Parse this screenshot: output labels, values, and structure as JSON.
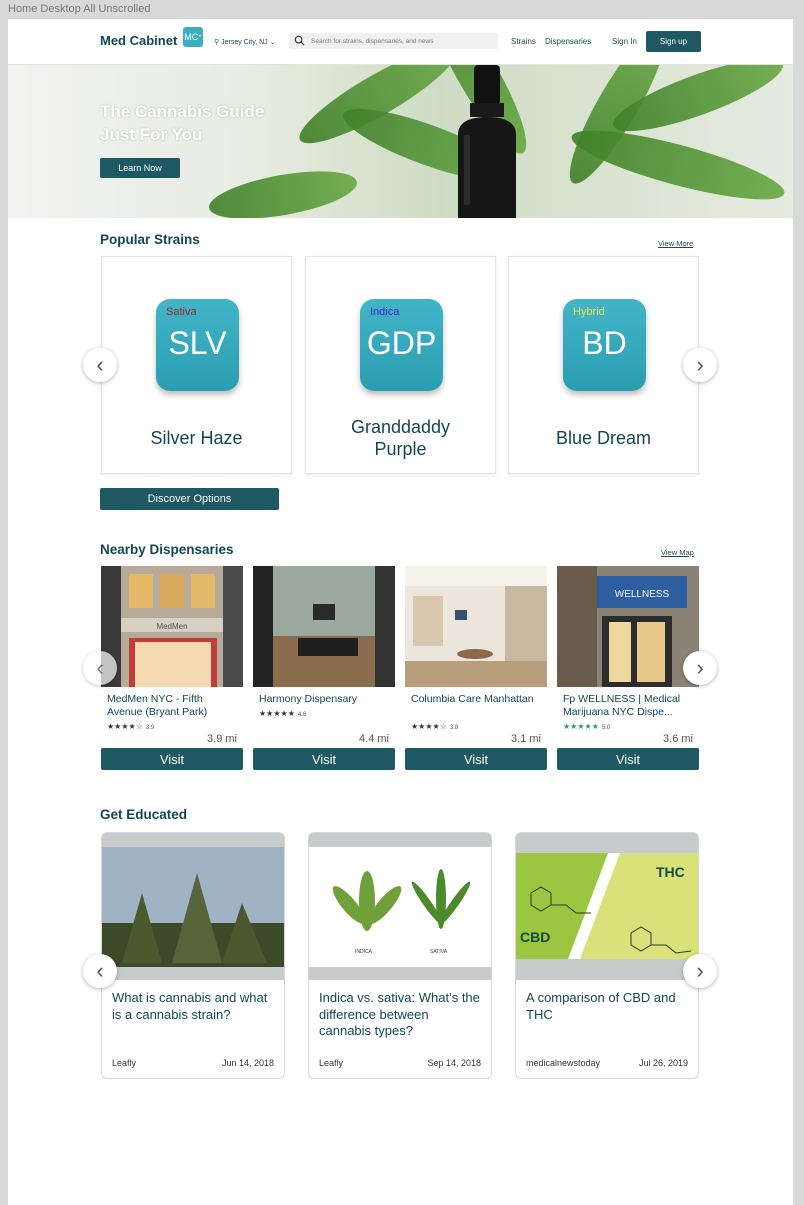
{
  "frame_title": "Home Desktop All Unscrolled",
  "header": {
    "logo_text": "Med Cabinet",
    "logo_badge": "MC",
    "location": "Jersey City, NJ",
    "search_placeholder": "Search for strains, dispensaries, and news",
    "nav": [
      "Strains",
      "Dispensaries"
    ],
    "sign_in": "Sign In",
    "sign_up": "Sign up"
  },
  "hero": {
    "title_line1": "The Cannabis Guide",
    "title_line2": "Just For You",
    "button": "Learn Now"
  },
  "popular": {
    "title": "Popular Strains",
    "view_more": "View More",
    "strains": [
      {
        "type": "Sativa",
        "abbr": "SLV",
        "name_line1": "Silver Haze",
        "name_line2": "",
        "type_color": "#8b2a2a"
      },
      {
        "type": "Indica",
        "abbr": "GDP",
        "name_line1": "Granddaddy",
        "name_line2": "Purple",
        "type_color": "#3b22c9"
      },
      {
        "type": "Hybrid",
        "abbr": "BD",
        "name_line1": "Blue Dream",
        "name_line2": "",
        "type_color": "#f2e84a"
      }
    ],
    "discover": "Discover Options"
  },
  "dispensaries": {
    "title": "Nearby Dispensaries",
    "view_map": "View Map",
    "items": [
      {
        "name": "MedMen NYC - Fifth Avenue (Bryant Park)",
        "stars": "★★★★☆",
        "rating": "3.9",
        "distance": "3.9 mi",
        "visit": "Visit"
      },
      {
        "name": "Harmony Dispensary",
        "stars": "★★★★★",
        "rating": "4.6",
        "distance": "4.4 mi",
        "visit": "Visit"
      },
      {
        "name": "Columbia Care Manhattan",
        "stars": "★★★★☆",
        "rating": "3.8",
        "distance": "3.1 mi",
        "visit": "Visit"
      },
      {
        "name": "Fp WELLNESS | Medical Marijuana NYC Dispe...",
        "stars": "★★★★★",
        "rating": "5.0",
        "distance": "3.6 mi",
        "visit": "Visit"
      }
    ]
  },
  "education": {
    "title": "Get Educated",
    "articles": [
      {
        "title": "What is cannabis and what is a cannabis strain?",
        "source": "Leafly",
        "date": "Jun 14, 2018"
      },
      {
        "title": "Indica vs. sativa: What’s the difference between cannabis types?",
        "source": "Leafly",
        "date": "Sep 14, 2018",
        "label_left": "INDICA",
        "label_right": "SATIVA"
      },
      {
        "title": "A comparison of CBD and THC",
        "source": "medicalnewstoday",
        "date": "Jul 26, 2019",
        "label_left": "CBD",
        "label_right": "THC"
      }
    ]
  },
  "colors": {
    "primary": "#1d5863",
    "accent": "#3aaec3",
    "text": "#124752"
  }
}
